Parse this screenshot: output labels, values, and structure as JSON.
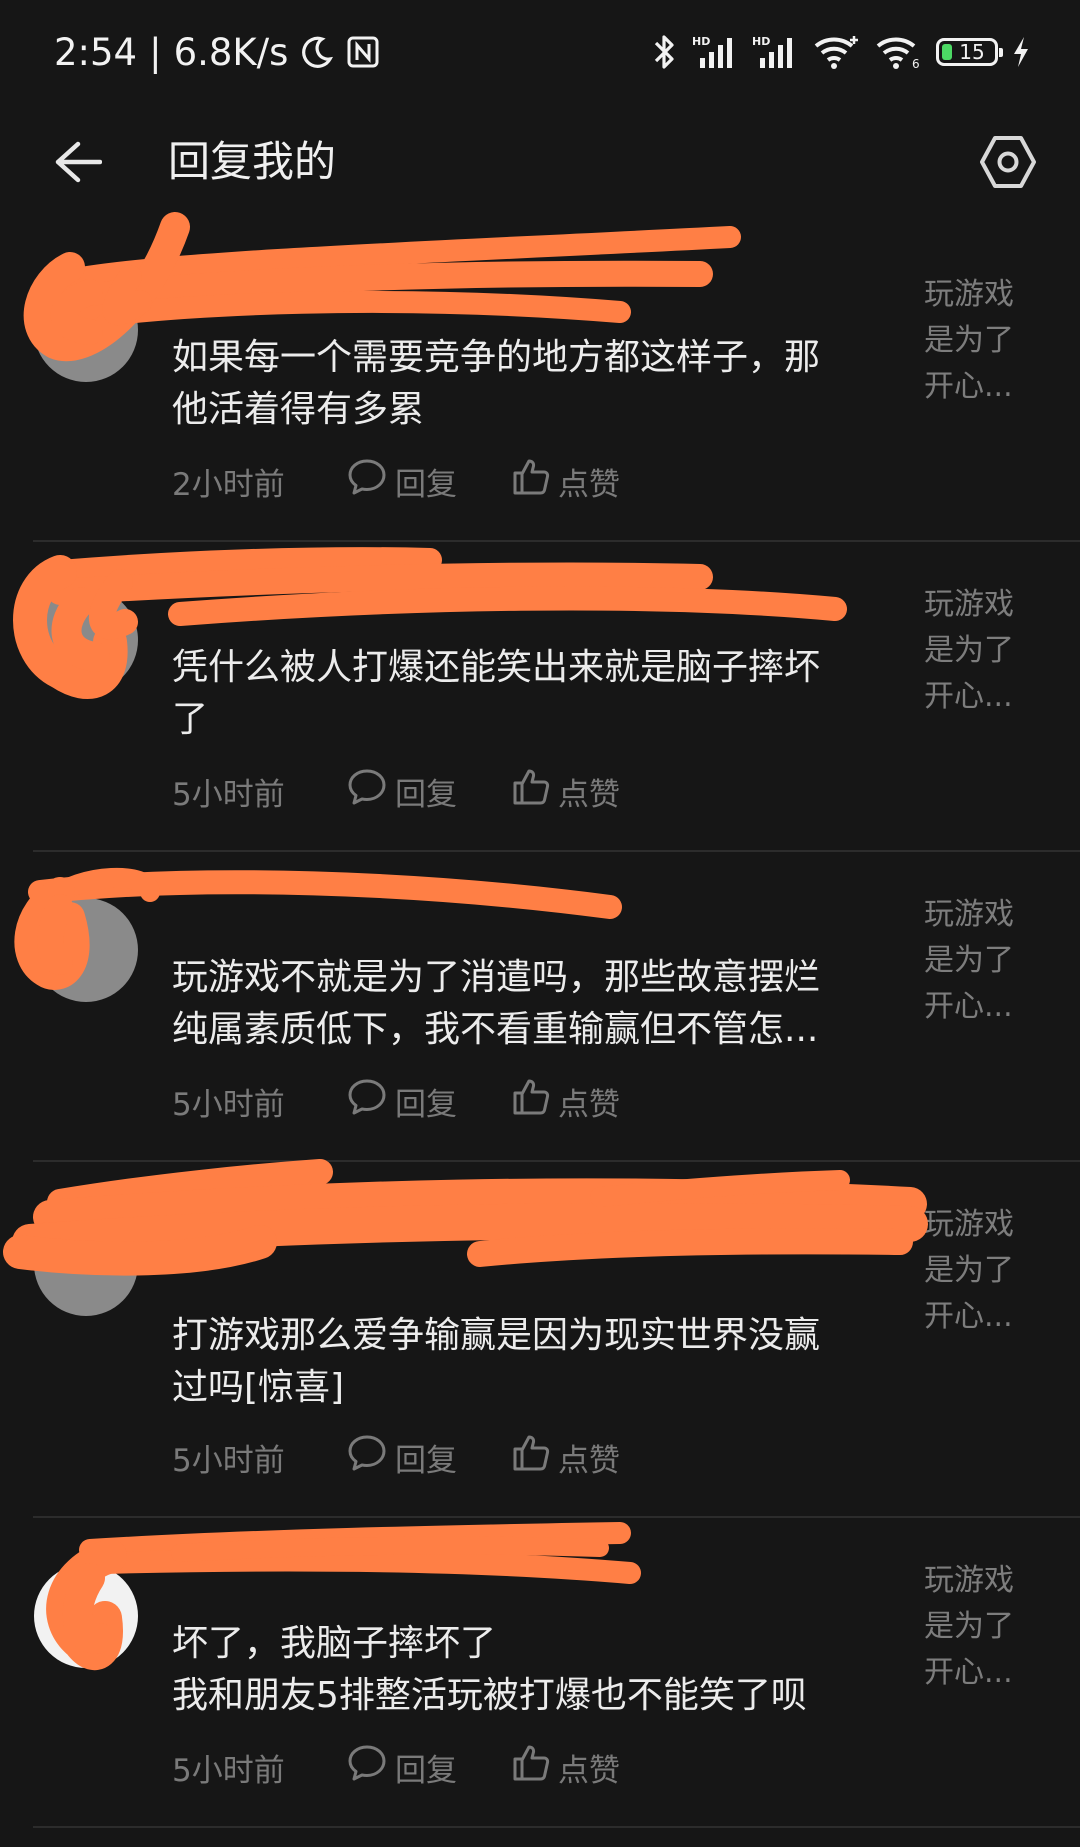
{
  "status_bar": {
    "time": "2:54",
    "network_speed": "6.8K/s",
    "battery_level": "15",
    "icons": [
      "moon-icon",
      "nfc-icon",
      "bluetooth-icon",
      "hd-signal-icon",
      "hd-signal-icon",
      "wifi-icon",
      "wifi6-icon",
      "battery-icon",
      "charging-icon"
    ]
  },
  "header": {
    "title": "回复我的",
    "back_icon": "arrow-left-icon",
    "settings_icon": "hexagon-settings-icon"
  },
  "replies": [
    {
      "comment_lines": [
        "如果每一个需要竞争的地方都这样子，那",
        "他活着得有多累"
      ],
      "time": "2小时前",
      "reply_label": "回复",
      "like_label": "点赞",
      "source_lines": [
        "玩游戏",
        "是为了",
        "开心..."
      ]
    },
    {
      "comment_lines": [
        "凭什么被人打爆还能笑出来就是脑子摔坏",
        "了"
      ],
      "time": "5小时前",
      "reply_label": "回复",
      "like_label": "点赞",
      "source_lines": [
        "玩游戏",
        "是为了",
        "开心..."
      ]
    },
    {
      "comment_lines": [
        "玩游戏不就是为了消遣吗，那些故意摆烂",
        "纯属素质低下，我不看重输赢但不管怎..."
      ],
      "time": "5小时前",
      "reply_label": "回复",
      "like_label": "点赞",
      "source_lines": [
        "玩游戏",
        "是为了",
        "开心..."
      ]
    },
    {
      "comment_lines": [
        "打游戏那么爱争输赢是因为现实世界没赢",
        "过吗[惊喜]"
      ],
      "time": "5小时前",
      "reply_label": "回复",
      "like_label": "点赞",
      "source_lines": [
        "玩游戏",
        "是为了",
        "开心..."
      ]
    },
    {
      "comment_lines": [
        "坏了，我脑子摔坏了",
        "我和朋友5排整活玩被打爆也不能笑了呗"
      ],
      "time": "5小时前",
      "reply_label": "回复",
      "like_label": "点赞",
      "source_lines": [
        "玩游戏",
        "是为了",
        "开心..."
      ]
    }
  ],
  "colors": {
    "background": "#161616",
    "divider": "#2c2c2c",
    "redaction": "#ff7f45",
    "text_primary": "#ececec",
    "text_secondary": "#7a7a7a"
  }
}
